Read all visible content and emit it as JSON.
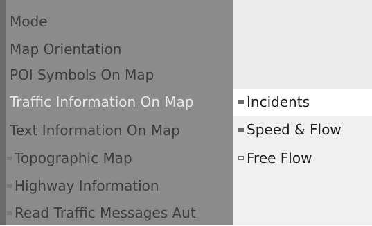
{
  "menu": {
    "items": [
      {
        "label": "Mode"
      },
      {
        "label": "Map Orientation"
      },
      {
        "label": "POI Symbols On Map"
      },
      {
        "label": "Traffic Information On Map"
      },
      {
        "label": "Text Information On Map"
      },
      {
        "label": "Topographic Map"
      },
      {
        "label": "Highway Information"
      },
      {
        "label": "Read Traffic Messages Aut"
      }
    ],
    "highlight_color": "#e6e6e6",
    "background_color": "#8b8b8b"
  },
  "submenu": {
    "items": [
      {
        "label": "Incidents",
        "state": "selected"
      },
      {
        "label": "Speed & Flow",
        "state": "checked"
      },
      {
        "label": "Free Flow",
        "state": "unchecked"
      }
    ]
  }
}
